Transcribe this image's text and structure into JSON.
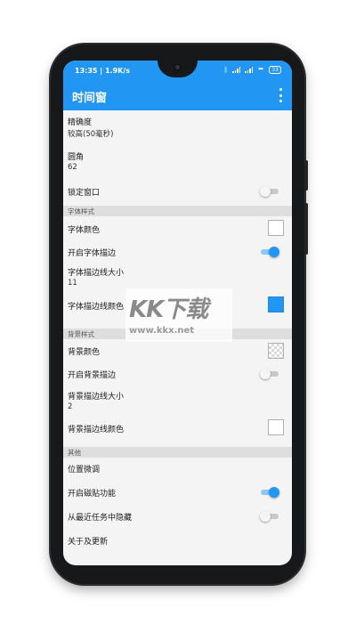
{
  "status_bar": {
    "time_speed": "13:35 | 1.9K/s",
    "battery": "33"
  },
  "app_bar": {
    "title": "时间窗"
  },
  "settings": {
    "precision": {
      "label": "精确度",
      "value": "较高(50毫秒)"
    },
    "corner": {
      "label": "圆角",
      "value": "62"
    },
    "lock_window": {
      "label": "锁定窗口",
      "on": false
    },
    "font_section": "字体样式",
    "font_color": {
      "label": "字体颜色",
      "swatch": "#ffffff"
    },
    "font_stroke": {
      "label": "开启字体描边",
      "on": true
    },
    "font_stroke_size": {
      "label": "字体描边线大小",
      "value": "11"
    },
    "font_stroke_color": {
      "label": "字体描边线颜色",
      "swatch": "#2196f3"
    },
    "bg_section": "背景样式",
    "bg_color": {
      "label": "背景颜色",
      "swatch": "transparent"
    },
    "bg_stroke": {
      "label": "开启背景描边",
      "on": false
    },
    "bg_stroke_size": {
      "label": "背景描边线大小",
      "value": "2"
    },
    "bg_stroke_color": {
      "label": "背景描边线颜色",
      "swatch": "#ffffff"
    },
    "other_section": "其他",
    "position_adjust": {
      "label": "位置微调"
    },
    "snap": {
      "label": "开启磁贴功能",
      "on": true
    },
    "hide_recent": {
      "label": "从最近任务中隐藏",
      "on": false
    },
    "about": {
      "label": "关于及更新"
    }
  },
  "watermark": {
    "logo": "KK下载",
    "url": "www.kkx.net"
  },
  "colors": {
    "accent": "#2196f3",
    "section_bg": "#dedede"
  }
}
